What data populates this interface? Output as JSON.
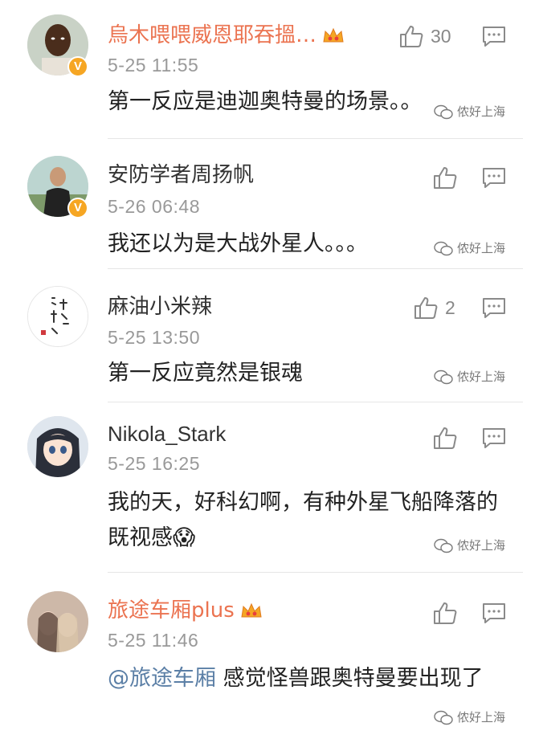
{
  "comments": [
    {
      "username": "烏木喂喂威恩耶吞搵…",
      "timestamp": "5-25 11:55",
      "text": "第一反应是迪迦奥特曼的场景。。",
      "like_count": "30",
      "verified_badge": "V",
      "vip": true,
      "avatar_icon": "man-dark-skin-avatar",
      "watermark": "侬好上海"
    },
    {
      "username": "安防学者周扬帆",
      "timestamp": "5-26 06:48",
      "text": "我还以为是大战外星人。。。",
      "like_count": "",
      "verified_badge": "V",
      "vip": false,
      "avatar_icon": "man-outdoor-avatar",
      "watermark": "侬好上海"
    },
    {
      "username": "麻油小米辣",
      "timestamp": "5-25 13:50",
      "text": "第一反应竟然是银魂",
      "like_count": "2",
      "verified_badge": "",
      "vip": false,
      "avatar_icon": "calligraphy-avatar",
      "watermark": "侬好上海"
    },
    {
      "username": "Nikola_Stark",
      "timestamp": "5-25 16:25",
      "text": "我的天，好科幻啊，有种外星飞船降落的既视感😱",
      "like_count": "",
      "verified_badge": "",
      "vip": false,
      "avatar_icon": "anime-girl-avatar",
      "watermark": "侬好上海"
    },
    {
      "username": "旅途车厢plus",
      "timestamp": "5-25 11:46",
      "mention": "@旅途车厢",
      "text": " 感觉怪兽跟奥特曼要出现了",
      "like_count": "",
      "verified_badge": "",
      "vip": true,
      "avatar_icon": "two-girls-illustration-avatar",
      "watermark": "侬好上海"
    }
  ],
  "colors": {
    "vip_name": "#eb7350",
    "mention": "#5b7fa6",
    "timestamp": "#999999",
    "badge": "#f6a623"
  }
}
